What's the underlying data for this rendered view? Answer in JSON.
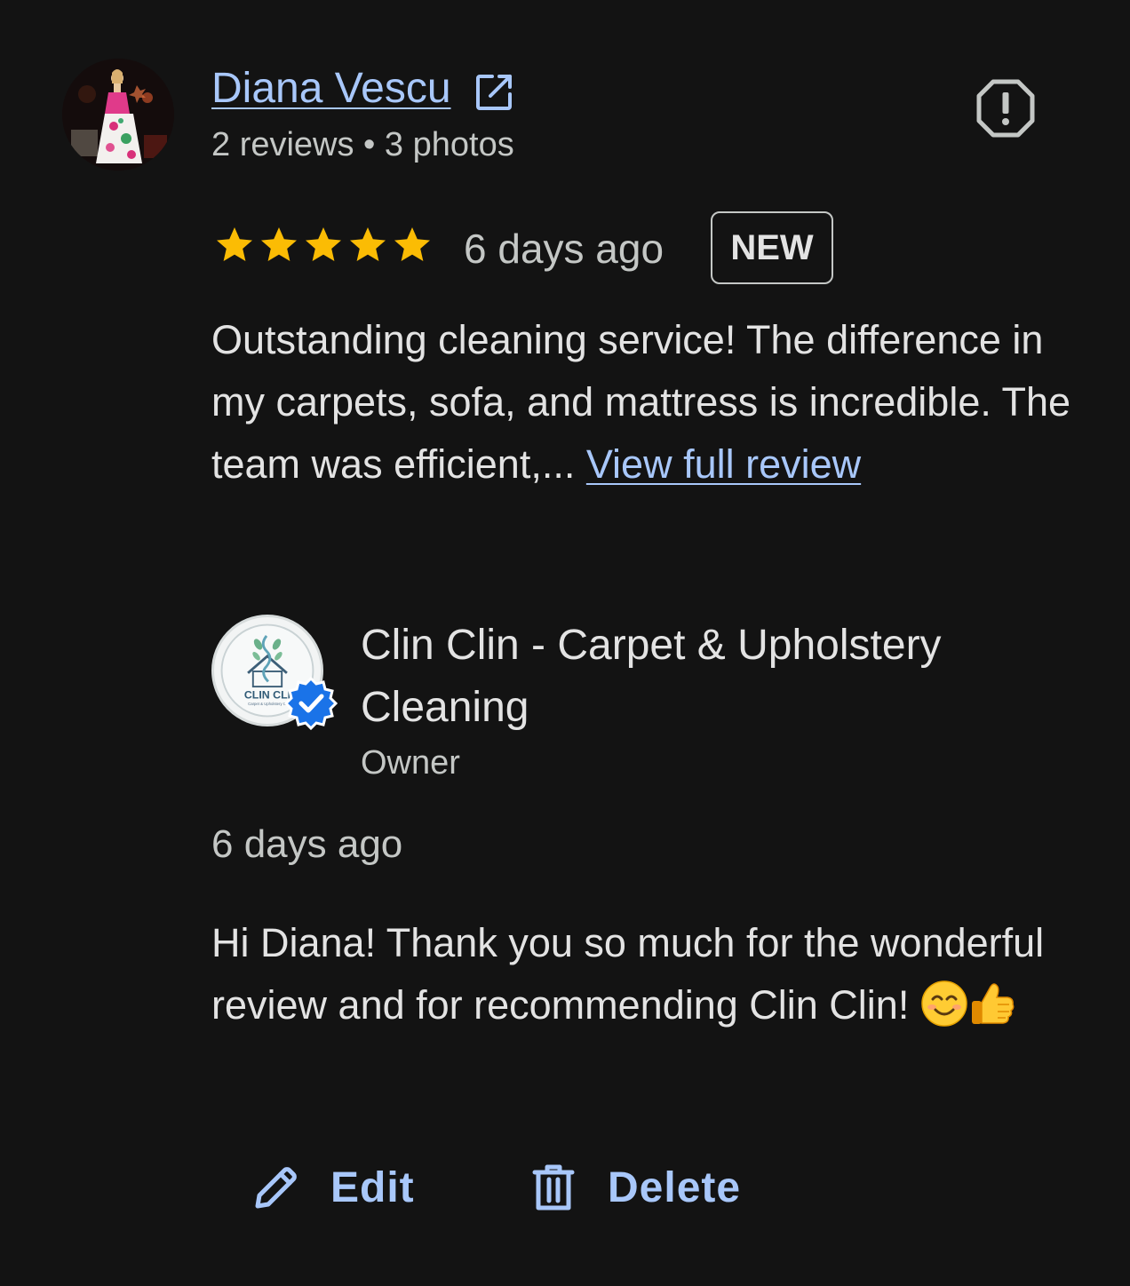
{
  "reviewer": {
    "name": "Diana Vescu",
    "meta": "2 reviews • 3 photos"
  },
  "review": {
    "rating": 5,
    "date": "6 days ago",
    "badge": "NEW",
    "text": "Outstanding cleaning service! The difference in my carpets, sofa, and mattress is incredible. The team was efficient,... ",
    "view_full": "View full review"
  },
  "owner": {
    "name": "Clin Clin - Carpet & Upholstery Cleaning",
    "role": "Owner",
    "logo_text": "CLIN CLI",
    "logo_subtext": "Carpet & Upholstery Cl",
    "reply_date": "6 days ago",
    "reply_text": "Hi Diana! Thank you so much for the wonderful review and for recommending Clin Clin! "
  },
  "actions": {
    "edit": "Edit",
    "delete": "Delete"
  },
  "icons": {
    "external_link": "open-in-new-icon",
    "report": "report-icon",
    "star": "star-icon",
    "verified": "verified-badge-icon",
    "edit": "pencil-icon",
    "delete": "trash-icon"
  },
  "colors": {
    "background": "#131313",
    "link": "#a8c7fa",
    "star": "#fbbc04",
    "verified": "#1a73e8"
  }
}
